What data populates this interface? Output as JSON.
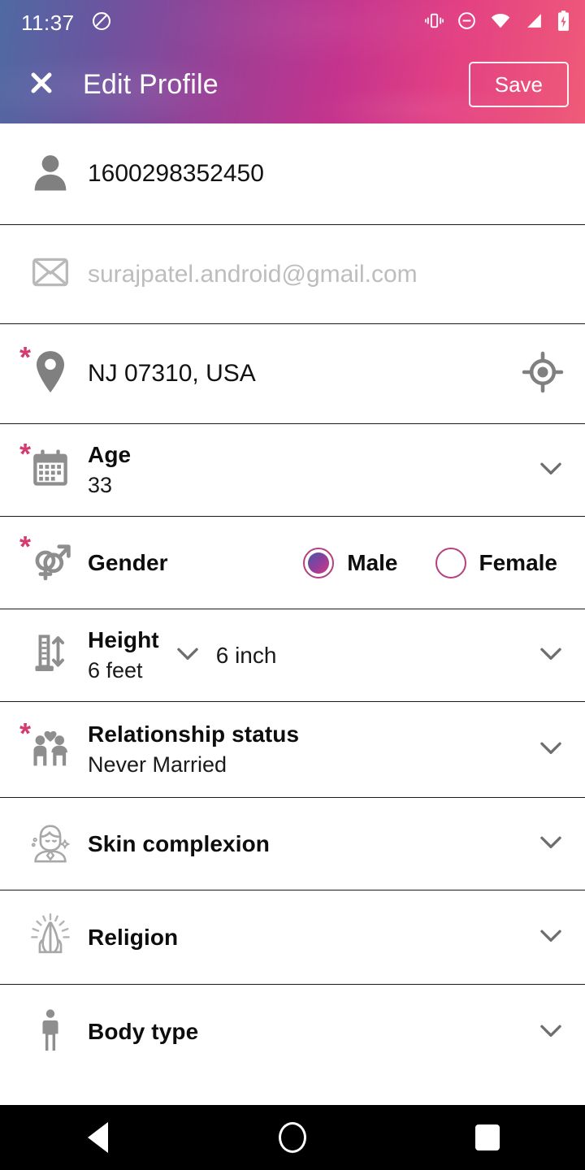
{
  "status_bar": {
    "time": "11:37",
    "icons": [
      "circle-slash-icon",
      "vibrate-icon",
      "do-not-disturb-icon",
      "wifi-icon",
      "signal-icon",
      "battery-charging-icon"
    ]
  },
  "app_bar": {
    "close_icon": "close-icon",
    "title": "Edit Profile",
    "save_label": "Save"
  },
  "colors": {
    "gradient_start": "#4f6aa3",
    "gradient_mid": "#9c3f96",
    "gradient_end": "#ef5b78",
    "required_asterisk": "#d33b72",
    "radio_accent": "#b5407f",
    "icon_gray": "#8a8a8a",
    "placeholder_gray": "#bdbdbd"
  },
  "rows": {
    "name": {
      "icon": "person-icon",
      "value": "1600298352450",
      "required": false
    },
    "email": {
      "icon": "envelope-icon",
      "placeholder": "surajpatel.android@gmail.com",
      "value": "",
      "required": false
    },
    "location": {
      "icon": "map-pin-icon",
      "value": "NJ 07310, USA",
      "required": true,
      "action_icon": "my-location-icon"
    },
    "age": {
      "icon": "calendar-icon",
      "label": "Age",
      "value": "33",
      "required": true,
      "chevron": "chevron-down-icon"
    },
    "gender": {
      "icon": "gender-symbols-icon",
      "label": "Gender",
      "required": true,
      "options": [
        {
          "label": "Male",
          "selected": true
        },
        {
          "label": "Female",
          "selected": false
        }
      ]
    },
    "height": {
      "icon": "ruler-icon",
      "label": "Height",
      "feet_value": "6 feet",
      "inch_value": "6 inch",
      "required": false,
      "chevron": "chevron-down-icon"
    },
    "relationship": {
      "icon": "couple-icon",
      "label": "Relationship status",
      "value": "Never Married",
      "required": true,
      "chevron": "chevron-down-icon"
    },
    "skin": {
      "icon": "face-beauty-icon",
      "label": "Skin complexion",
      "value": "",
      "required": false,
      "chevron": "chevron-down-icon"
    },
    "religion": {
      "icon": "praying-hands-icon",
      "label": "Religion",
      "value": "",
      "required": false,
      "chevron": "chevron-down-icon"
    },
    "body_type": {
      "icon": "standing-person-icon",
      "label": "Body type",
      "value": "",
      "required": false,
      "chevron": "chevron-down-icon"
    }
  },
  "nav_bar": {
    "back": "back-triangle-icon",
    "home": "home-circle-icon",
    "recents": "recents-square-icon"
  },
  "required_marker": "*"
}
